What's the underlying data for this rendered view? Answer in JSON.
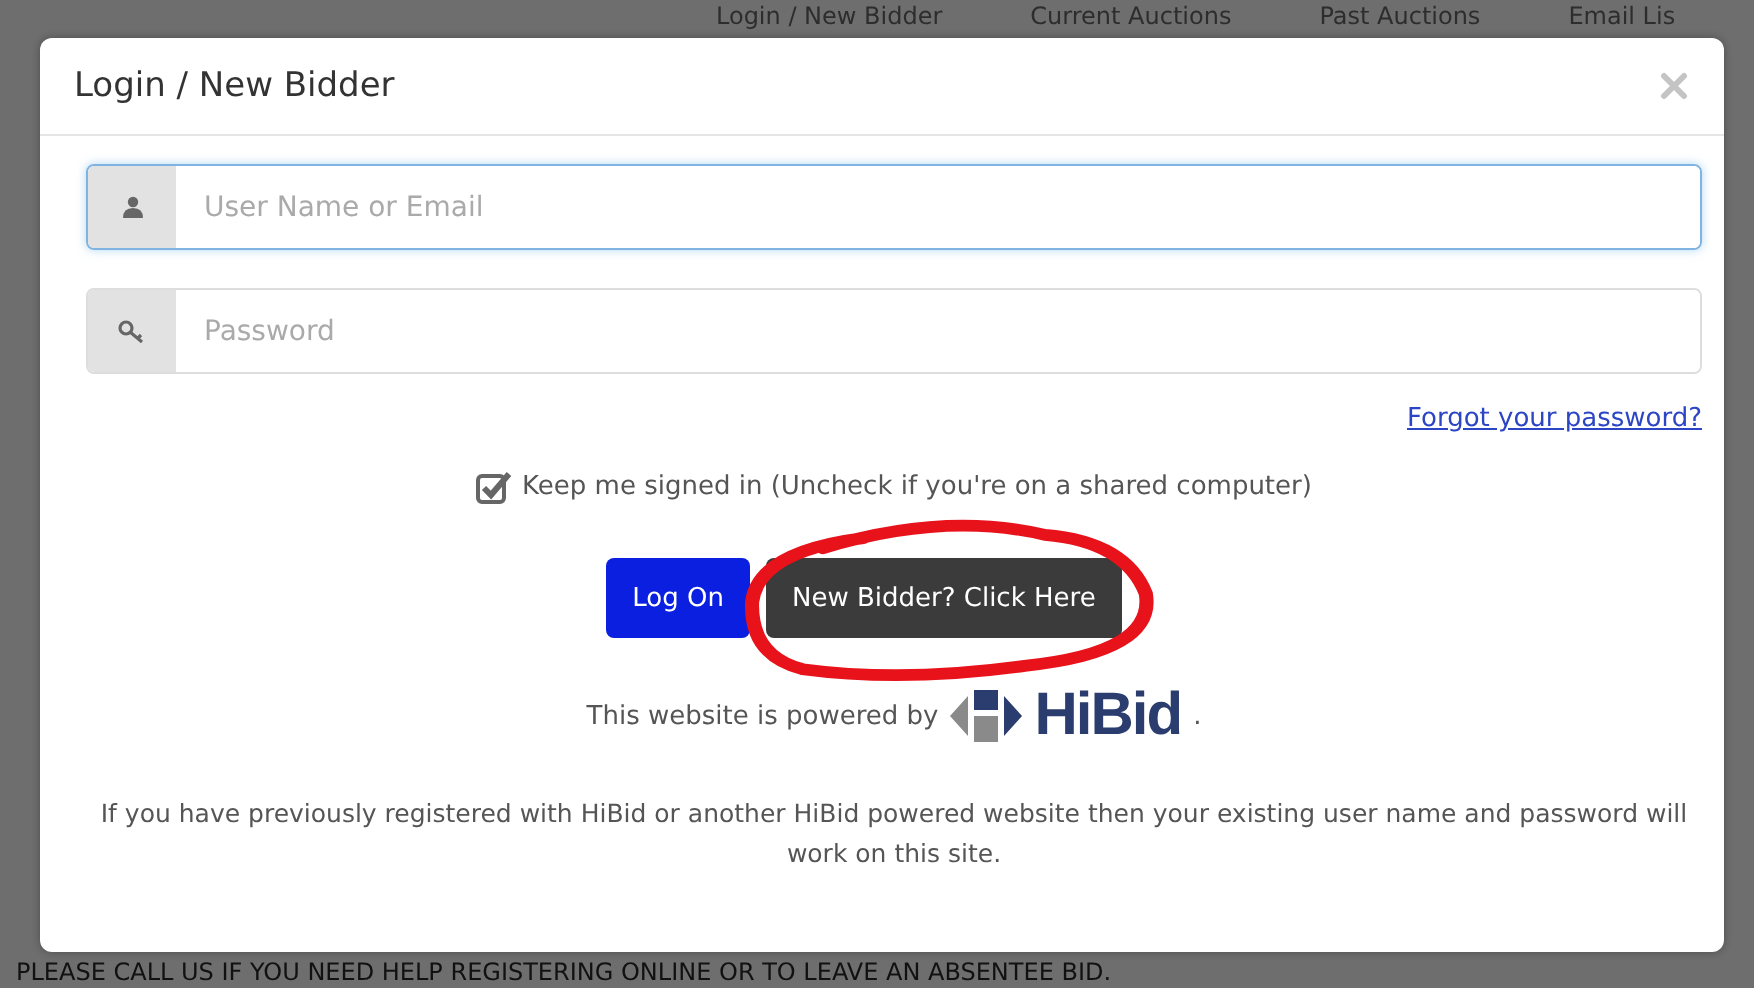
{
  "background_nav": [
    {
      "label": "Login / New Bidder"
    },
    {
      "label": "Current Auctions"
    },
    {
      "label": "Past Auctions"
    },
    {
      "label": "Email Lis"
    }
  ],
  "background_notice": "PLEASE CALL US IF YOU NEED HELP REGISTERING ONLINE OR TO LEAVE AN ABSENTEE BID.",
  "dialog": {
    "title": "Login / New Bidder",
    "fields": [
      {
        "kind": "user",
        "placeholder": "User Name or Email",
        "focused": true
      },
      {
        "kind": "key",
        "placeholder": "Password",
        "focused": false
      }
    ],
    "forgot_link": "Forgot your password?",
    "keep_signed_in": {
      "label": "Keep me signed in (Uncheck if you're on a shared computer)",
      "checked": true
    },
    "buttons": [
      {
        "label": "Log On",
        "kind": "primary",
        "circled": false
      },
      {
        "label": "New Bidder? Click Here",
        "kind": "dark",
        "circled": true
      }
    ],
    "powered_by": {
      "text": "This website is powered by",
      "brand": "HiBid",
      "suffix": "."
    },
    "footer_note": "If you have previously registered with HiBid or another HiBid powered website then your existing user name and password will work on this site."
  }
}
